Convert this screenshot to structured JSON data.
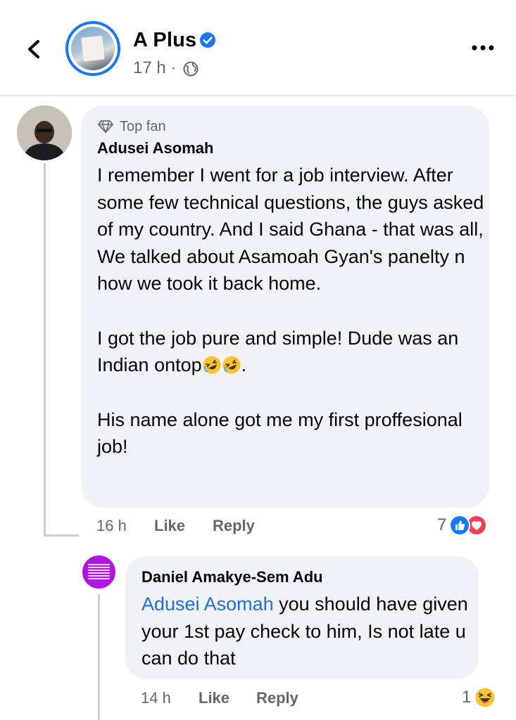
{
  "header": {
    "page_name": "A Plus",
    "post_time": "17 h ·"
  },
  "comment1": {
    "badge": "Top fan",
    "author": "Adusei Asomah",
    "paragraph1": "I remember I went for a job interview. After some few technical questions, the guys asked of my country. And I said Ghana - that was all,  We talked about Asamoah Gyan's panelty n how we took it back home.",
    "paragraph2_text": "I got the job pure and simple! Dude was an Indian ontop",
    "paragraph2_end": ".",
    "paragraph3": "His name alone got me my first proffesional job!",
    "time": "16 h",
    "like_label": "Like",
    "reply_label": "Reply",
    "reaction_count": "7"
  },
  "reply1": {
    "author": "Daniel Amakye-Sem Adu",
    "mention": "Adusei Asomah",
    "text": " you should have given your 1st pay check to him, Is not late u can do that",
    "time": "14 h",
    "like_label": "Like",
    "reply_label": "Reply",
    "reaction_count": "1"
  },
  "icons": {
    "back": "chevron-left-icon",
    "verified": "verified-badge-icon",
    "audience": "globe-icon",
    "more": "more-options-icon",
    "top_fan": "diamond-icon",
    "like_reaction": "like-reaction-icon",
    "love_reaction": "love-reaction-icon",
    "haha_reaction": "haha-reaction-icon",
    "laughing_emoji": "rolling-laughing-emoji-icon"
  },
  "colors": {
    "accent": "#1877f2",
    "bubble": "#f0f2f5",
    "secondary_text": "#65676b",
    "mention": "#216fdb",
    "love": "#f33e58",
    "reply_avatar": "#b014e0"
  }
}
